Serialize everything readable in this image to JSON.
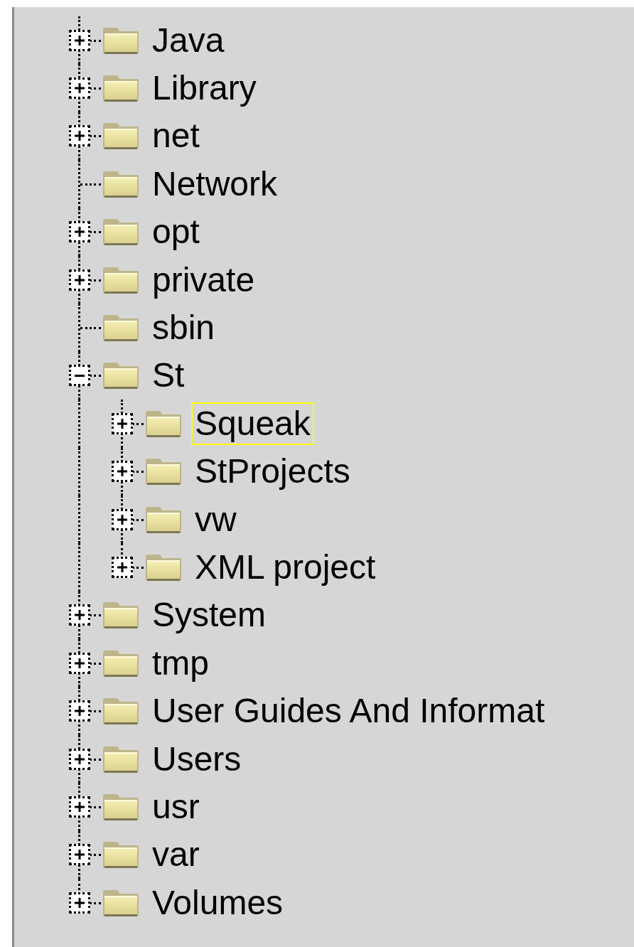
{
  "tree": {
    "items": [
      {
        "label": "Java",
        "kind": "branch",
        "expanded": false,
        "selected": false
      },
      {
        "label": "Library",
        "kind": "branch",
        "expanded": false,
        "selected": false
      },
      {
        "label": "net",
        "kind": "branch",
        "expanded": false,
        "selected": false
      },
      {
        "label": "Network",
        "kind": "leaf",
        "selected": false
      },
      {
        "label": "opt",
        "kind": "branch",
        "expanded": false,
        "selected": false
      },
      {
        "label": "private",
        "kind": "branch",
        "expanded": false,
        "selected": false
      },
      {
        "label": "sbin",
        "kind": "leaf",
        "selected": false
      },
      {
        "label": "St",
        "kind": "branch",
        "expanded": true,
        "selected": false,
        "children": [
          {
            "label": "Squeak",
            "kind": "branch",
            "expanded": false,
            "selected": true
          },
          {
            "label": "StProjects",
            "kind": "branch",
            "expanded": false,
            "selected": false
          },
          {
            "label": "vw",
            "kind": "branch",
            "expanded": false,
            "selected": false
          },
          {
            "label": "XML project",
            "kind": "branch",
            "expanded": false,
            "selected": false
          }
        ]
      },
      {
        "label": "System",
        "kind": "branch",
        "expanded": false,
        "selected": false
      },
      {
        "label": "tmp",
        "kind": "branch",
        "expanded": false,
        "selected": false
      },
      {
        "label": "User Guides And Informat",
        "kind": "branch",
        "expanded": false,
        "selected": false
      },
      {
        "label": "Users",
        "kind": "branch",
        "expanded": false,
        "selected": false
      },
      {
        "label": "usr",
        "kind": "branch",
        "expanded": false,
        "selected": false
      },
      {
        "label": "var",
        "kind": "branch",
        "expanded": false,
        "selected": false
      },
      {
        "label": "Volumes",
        "kind": "branch",
        "expanded": false,
        "selected": false
      }
    ]
  }
}
